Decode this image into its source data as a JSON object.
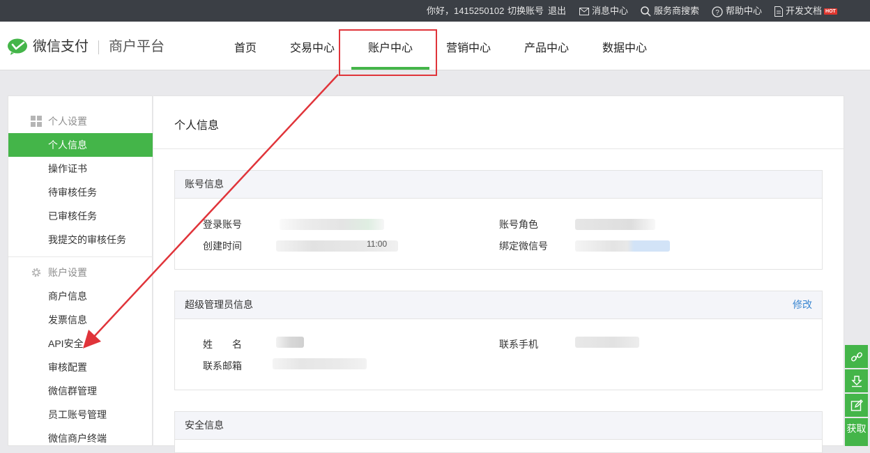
{
  "topbar": {
    "greeting": "你好，1415250102",
    "switch_account": "切换账号",
    "logout": "退出",
    "messages": "消息中心",
    "provider_search": "服务商搜索",
    "help": "帮助中心",
    "docs": "开发文档",
    "hot_badge": "HOT"
  },
  "header": {
    "brand": "微信支付",
    "platform": "商户平台",
    "nav": [
      "首页",
      "交易中心",
      "账户中心",
      "营销中心",
      "产品中心",
      "数据中心"
    ],
    "active_nav": "账户中心"
  },
  "sidebar": {
    "group1": "个人设置",
    "group1_items": [
      "个人信息",
      "操作证书",
      "待审核任务",
      "已审核任务",
      "我提交的审核任务"
    ],
    "group2": "账户设置",
    "group2_items": [
      "商户信息",
      "发票信息",
      "API安全",
      "审核配置",
      "微信群管理",
      "员工账号管理",
      "微信商户终端"
    ],
    "active_item": "个人信息"
  },
  "main": {
    "title": "个人信息",
    "account_panel": {
      "title": "账号信息",
      "login_account": "登录账号",
      "created_time": "创建时间",
      "account_role": "账号角色",
      "bound_wechat": "绑定微信号",
      "created_fragment": "11:00"
    },
    "admin_panel": {
      "title": "超级管理员信息",
      "edit": "修改",
      "name": "姓　　名",
      "email": "联系邮箱",
      "phone": "联系手机"
    },
    "security_panel": {
      "title": "安全信息"
    }
  },
  "rightbar": {
    "get_label": "获取"
  },
  "colors": {
    "brand_green": "#44b549",
    "topbar_bg": "#3b3f45",
    "highlight_red": "#e0343a",
    "link_blue": "#3a86d1"
  }
}
